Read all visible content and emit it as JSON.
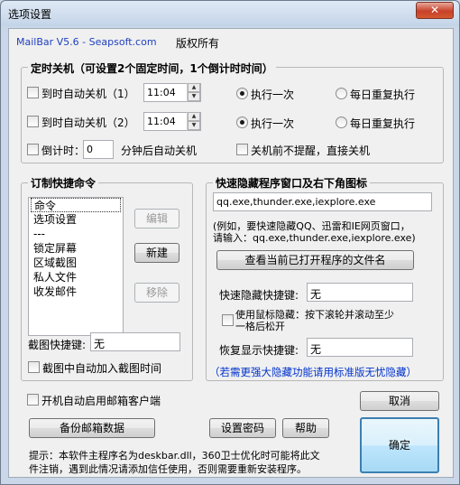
{
  "window": {
    "title": "选项设置",
    "close_label": "✕"
  },
  "header": {
    "product": "MailBar V5.6 - Seapsoft.com",
    "copyright": "版权所有"
  },
  "shutdown": {
    "group_title": "定时关机（可设置2个固定时间，1个倒计时时间）",
    "row1": {
      "label": "到时自动关机（1）",
      "checked": false,
      "time": "11:04",
      "once": "执行一次",
      "daily": "每日重复执行",
      "mode": "once"
    },
    "row2": {
      "label": "到时自动关机（2）",
      "checked": false,
      "time": "11:04",
      "once": "执行一次",
      "daily": "每日重复执行",
      "mode": "once"
    },
    "countdown": {
      "label": "倒计时：",
      "value": "0",
      "suffix": "分钟后自动关机",
      "checked": false
    },
    "no_prompt": {
      "label": "关机前不提醒，直接关机",
      "checked": false
    }
  },
  "commands": {
    "group_title": "订制快捷命令",
    "items": [
      "命令",
      "选项设置",
      "---",
      "锁定屏幕",
      "区域截图",
      "私人文件",
      "收发邮件"
    ],
    "selected_index": 0,
    "edit_label": "编辑",
    "new_label": "新建",
    "remove_label": "移除",
    "hotkey_label": "截图快捷键:",
    "hotkey_value": "无",
    "auto_time_label": "截图中自动加入截图时间",
    "auto_time_checked": false
  },
  "hide": {
    "group_title": "快速隐藏程序窗口及右下角图标",
    "programs": "qq.exe,thunder.exe,iexplore.exe",
    "hint1": "(例如，要快速隐藏QQ、迅雷和IE网页窗口，",
    "hint2": "请输入：qq.exe,thunder.exe,iexplore.exe)",
    "view_button": "查看当前已打开程序的文件名",
    "hide_hotkey_label": "快速隐藏快捷键:",
    "hide_hotkey_value": "无",
    "mouse_hide_label1": "使用鼠标隐藏：按下滚轮并滚动至少",
    "mouse_hide_label2": "一格后松开",
    "mouse_hide_checked": false,
    "restore_hotkey_label": "恢复显示快捷键:",
    "restore_hotkey_value": "无",
    "notice": "（若需更强大隐藏功能请用标准版无忧隐藏）"
  },
  "footer": {
    "startup_label": "开机自动启用邮箱客户端",
    "startup_checked": false,
    "backup_label": "备份邮箱数据",
    "password_label": "设置密码",
    "help_label": "帮助",
    "cancel_label": "取消",
    "ok_label": "确定",
    "tip1": "提示：本软件主程序名为deskbar.dll，360卫士优化时可能将此文",
    "tip2": "件注销，遇到此情况请添加信任使用，否则需要重新安装程序。"
  },
  "colors": {
    "accent_blue": "#0033cc",
    "titlebar": "#c4d4e8",
    "close_red": "#c7402a"
  }
}
